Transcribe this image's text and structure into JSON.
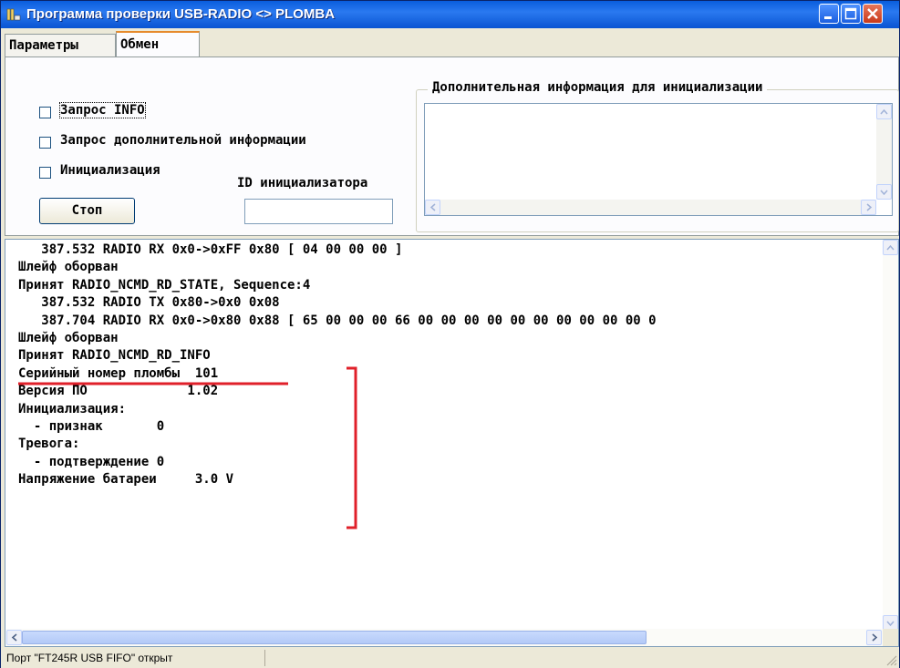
{
  "window": {
    "title": "Программа проверки USB-RADIO <> PLOMBA",
    "icons": {
      "app": "app-icon",
      "minimize": "minimize-icon",
      "maximize": "maximize-icon",
      "close": "close-icon"
    }
  },
  "tabs": [
    {
      "label": "Параметры",
      "active": false
    },
    {
      "label": "Обмен",
      "active": true
    }
  ],
  "exchange": {
    "checkboxes": [
      {
        "label": "Запрос INFO",
        "checked": false
      },
      {
        "label": "Запрос дополнительной информации",
        "checked": false
      },
      {
        "label": "Инициализация",
        "checked": false
      }
    ],
    "stop_button": "Стоп",
    "initiator_id_label": "ID инициализатора",
    "initiator_id_value": "",
    "extra_info_group_title": "Дополнительная информация для инициализации",
    "extra_info_value": ""
  },
  "log": {
    "lines": [
      "   387.532 RADIO RX 0x0->0xFF 0x80 [ 04 00 00 00 ]",
      "Шлейф оборван",
      "Принят RADIO_NCMD_RD_STATE, Sequence:4",
      "   387.532 RADIO TX 0x80->0x0 0x08",
      "   387.704 RADIO RX 0x0->0x80 0x88 [ 65 00 00 00 66 00 00 00 00 00 00 00 00 00 00 0",
      "Шлейф оборван",
      "Принят RADIO_NCMD_RD_INFO",
      "Серийный номер пломбы  101",
      "Версия ПО             1.02",
      "Инициализация:",
      "  - признак       0",
      "Тревога:",
      "  - подтверждение 0",
      "Напряжение батареи     3.0 V"
    ]
  },
  "annotation": {
    "color": "#e0202a"
  },
  "status": {
    "text": "Порт \"FT245R USB FIFO\" открыт"
  }
}
